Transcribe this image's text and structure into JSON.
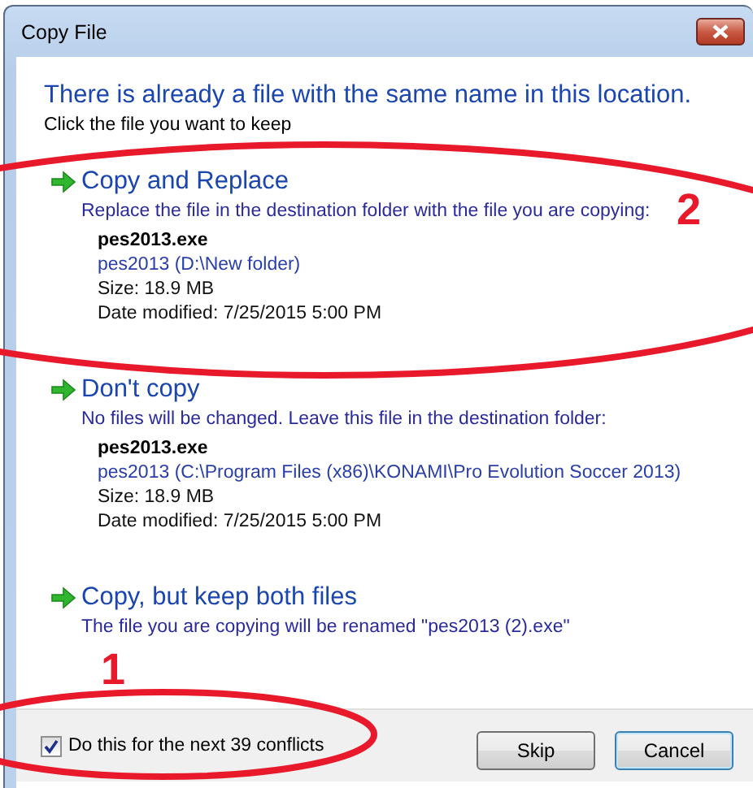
{
  "window": {
    "title": "Copy File"
  },
  "heading": "There is already a file with the same name in this location.",
  "instruction": "Click the file you want to keep",
  "options": [
    {
      "title": "Copy and Replace",
      "description": "Replace the file in the destination folder with the file you are copying:",
      "file": {
        "name": "pes2013.exe",
        "location": "pes2013 (D:\\New folder)",
        "size": "Size: 18.9 MB",
        "modified": "Date modified: 7/25/2015 5:00 PM"
      }
    },
    {
      "title": "Don't copy",
      "description": "No files will be changed. Leave this file in the destination folder:",
      "file": {
        "name": "pes2013.exe",
        "location": "pes2013 (C:\\Program Files (x86)\\KONAMI\\Pro Evolution Soccer 2013)",
        "size": "Size: 18.9 MB",
        "modified": "Date modified: 7/25/2015 5:00 PM"
      }
    },
    {
      "title": "Copy, but keep both files",
      "description": "The file you are copying will be renamed \"pes2013 (2).exe\""
    }
  ],
  "footer": {
    "apply_to_all": {
      "label": "Do this for the next 39 conflicts",
      "checked": true
    },
    "buttons": [
      {
        "label": "Skip",
        "focused": false
      },
      {
        "label": "Cancel",
        "focused": true
      }
    ]
  },
  "annotations": [
    {
      "kind": "ellipse"
    },
    {
      "kind": "number",
      "text": "2"
    },
    {
      "kind": "ellipse"
    },
    {
      "kind": "number",
      "text": "1"
    }
  ]
}
